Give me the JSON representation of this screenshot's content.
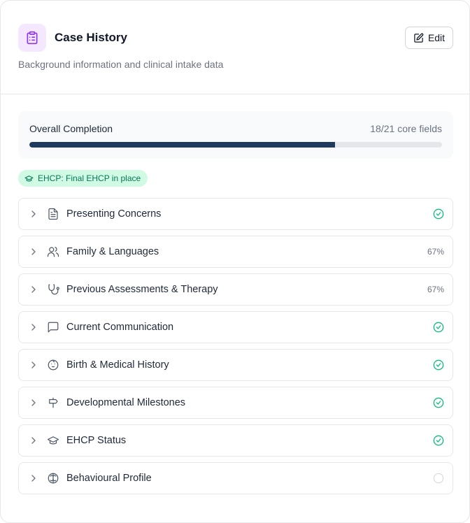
{
  "header": {
    "title": "Case History",
    "subtitle": "Background information and clinical intake data",
    "icon": "clipboard-icon",
    "edit_label": "Edit"
  },
  "progress": {
    "label": "Overall Completion",
    "count_text": "18/21 core fields",
    "completed": 18,
    "total": 21,
    "fill_fraction": 0.74
  },
  "badge": {
    "text": "EHCP: Final EHCP in place",
    "icon": "graduation-cap-icon"
  },
  "colors": {
    "accent": "#1e3a5f",
    "complete": "#10b981",
    "badge_bg": "#d1fae5",
    "badge_text": "#047857",
    "icon_bg": "#f3e8ff",
    "icon_fg": "#9333ea"
  },
  "sections": [
    {
      "label": "Presenting Concerns",
      "icon": "document-icon",
      "status": "complete"
    },
    {
      "label": "Family & Languages",
      "icon": "users-icon",
      "status": "partial",
      "percent": "67%"
    },
    {
      "label": "Previous Assessments & Therapy",
      "icon": "stethoscope-icon",
      "status": "partial",
      "percent": "67%"
    },
    {
      "label": "Current Communication",
      "icon": "message-icon",
      "status": "complete"
    },
    {
      "label": "Birth & Medical History",
      "icon": "baby-icon",
      "status": "complete"
    },
    {
      "label": "Developmental Milestones",
      "icon": "signpost-icon",
      "status": "complete"
    },
    {
      "label": "EHCP Status",
      "icon": "graduation-cap-icon",
      "status": "complete"
    },
    {
      "label": "Behavioural Profile",
      "icon": "brain-icon",
      "status": "empty"
    }
  ]
}
